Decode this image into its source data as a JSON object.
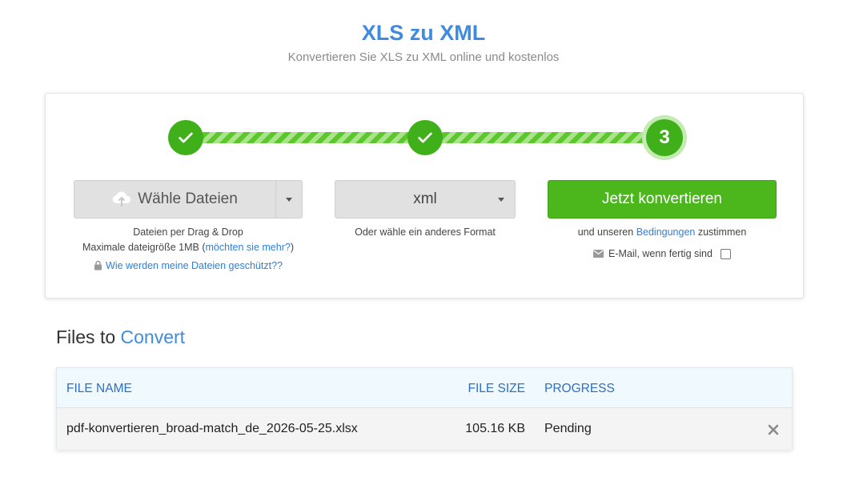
{
  "header": {
    "title": "XLS zu XML",
    "subtitle": "Konvertieren Sie XLS zu XML online und kostenlos"
  },
  "steps": {
    "step3_label": "3",
    "icons": [
      "check-icon",
      "check-icon"
    ]
  },
  "upload": {
    "button_label": "Wähle Dateien",
    "drag_drop": "Dateien per Drag & Drop",
    "max_size_prefix": "Maximale dateigröße 1MB (",
    "max_size_link": "möchten sie mehr?",
    "max_size_suffix": ")",
    "security_link": "Wie werden meine Dateien geschützt??"
  },
  "format": {
    "selected": "xml",
    "hint": "Oder wähle ein anderes Format"
  },
  "convert": {
    "button_label": "Jetzt konvertieren",
    "terms_prefix": "und unseren ",
    "terms_link": "Bedingungen",
    "terms_suffix": " zustimmen",
    "email_label": "E-Mail, wenn fertig sind"
  },
  "files": {
    "heading_prefix": "Files to ",
    "heading_accent": "Convert",
    "columns": {
      "name": "FILE NAME",
      "size": "FILE SIZE",
      "progress": "PROGRESS"
    },
    "rows": [
      {
        "name": "pdf-konvertieren_broad-match_de_2026-05-25.xlsx",
        "size": "105.16 KB",
        "progress": "Pending"
      }
    ]
  },
  "colors": {
    "accent_blue": "#3f8be0",
    "success_green": "#4cb71c",
    "step_green": "#3fb01a"
  }
}
